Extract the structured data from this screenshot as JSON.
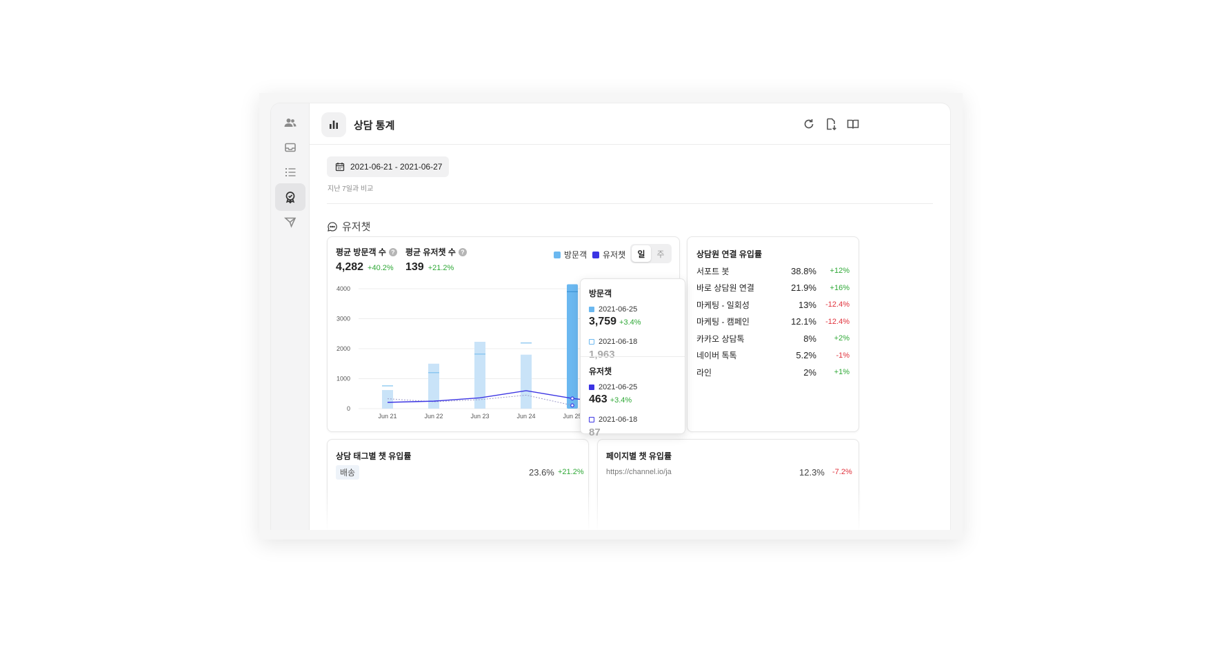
{
  "header": {
    "title": "상담 통계"
  },
  "date_filter": {
    "range": "2021-06-21 - 2021-06-27",
    "compare": "지난 7일과 비교"
  },
  "section": {
    "title": "유저챗"
  },
  "summary": {
    "visitors_label": "평균 방문객 수",
    "visitors_value": "4,282",
    "visitors_delta": "+40.2%",
    "chats_label": "평균 유저챗 수",
    "chats_value": "139",
    "chats_delta": "+21.2%",
    "help": "?"
  },
  "legend": {
    "visitors": "방문객",
    "chats": "유저챗"
  },
  "toggle": {
    "day": "일",
    "week": "주"
  },
  "colors": {
    "visitor_bar": "#c9e3f8",
    "visitor_bar_active": "#6bb8f0",
    "chat_line": "#3b34e3",
    "positive": "#2ea836",
    "negative": "#e0303a"
  },
  "chart_data": {
    "type": "bar",
    "categories": [
      "Jun 21",
      "Jun 22",
      "Jun 23",
      "Jun 24",
      "Jun 25"
    ],
    "yticks": [
      "0",
      "1000",
      "2000",
      "3000",
      "4000"
    ],
    "ylim": [
      0,
      4000
    ],
    "series": [
      {
        "name": "방문객",
        "type": "bar",
        "values": [
          620,
          1500,
          2230,
          1800,
          4150
        ]
      },
      {
        "name": "방문객 (이전)",
        "type": "marker",
        "values": [
          760,
          1200,
          1820,
          2190,
          3900
        ]
      },
      {
        "name": "유저챗",
        "type": "line",
        "values": [
          210,
          250,
          360,
          600,
          340
        ]
      },
      {
        "name": "유저챗 (이전)",
        "type": "dotted-line",
        "values": [
          330,
          230,
          300,
          450,
          110
        ]
      }
    ]
  },
  "tooltip": {
    "visitors_title": "방문객",
    "visitors_date": "2021-06-25",
    "visitors_value": "3,759",
    "visitors_delta": "+3.4%",
    "visitors_prev_date": "2021-06-18",
    "visitors_prev_value": "1,963",
    "chats_title": "유저챗",
    "chats_date": "2021-06-25",
    "chats_value": "463",
    "chats_delta": "+3.4%",
    "chats_prev_date": "2021-06-18",
    "chats_prev_value": "87"
  },
  "agent_rates": {
    "title": "상담원 연결 유입률",
    "rows": [
      {
        "name": "서포트 봇",
        "pct": "38.8%",
        "delta": "+12%",
        "dir": "pos"
      },
      {
        "name": "바로 상담원 연결",
        "pct": "21.9%",
        "delta": "+16%",
        "dir": "pos"
      },
      {
        "name": "마케팅 - 일회성",
        "pct": "13%",
        "delta": "-12.4%",
        "dir": "neg"
      },
      {
        "name": "마케팅 - 캠페인",
        "pct": "12.1%",
        "delta": "-12.4%",
        "dir": "neg"
      },
      {
        "name": "카카오 상담톡",
        "pct": "8%",
        "delta": "+2%",
        "dir": "pos"
      },
      {
        "name": "네이버 톡톡",
        "pct": "5.2%",
        "delta": "-1%",
        "dir": "neg"
      },
      {
        "name": "라인",
        "pct": "2%",
        "delta": "+1%",
        "dir": "pos"
      }
    ]
  },
  "tag_rates": {
    "title": "상담 태그별 챗 유입률",
    "tag": "배송",
    "pct": "23.6%",
    "delta": "+21.2%"
  },
  "page_rates": {
    "title": "페이지별 챗 유입률",
    "url": "https://channel.io/ja",
    "pct": "12.3%",
    "delta": "-7.2%"
  }
}
